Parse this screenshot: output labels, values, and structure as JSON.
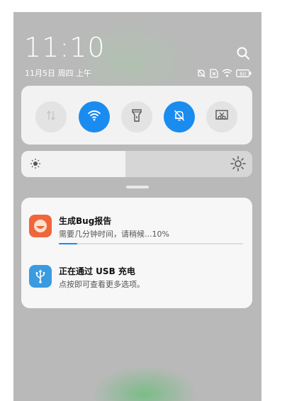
{
  "status": {
    "time": "11:10",
    "date": "11月5日 周四 上午",
    "battery_level": "60"
  },
  "icons": {
    "search": "search-icon",
    "status": [
      "do-not-disturb-icon",
      "no-sim-icon",
      "wifi-signal-icon",
      "battery-icon"
    ],
    "tiles": [
      "mobile-data-icon",
      "wifi-icon",
      "flashlight-icon",
      "mute-icon",
      "screenshot-icon"
    ]
  },
  "quick_settings": {
    "tiles": [
      {
        "id": "mobile-data",
        "active": false
      },
      {
        "id": "wifi",
        "active": true
      },
      {
        "id": "flashlight",
        "active": false
      },
      {
        "id": "mute",
        "active": true
      },
      {
        "id": "screenshot",
        "active": false
      }
    ]
  },
  "brightness": {
    "level": 0.45
  },
  "notifications": [
    {
      "title": "生成Bug报告",
      "text": "需要几分钟时间，请稍候...10%",
      "progress": 0.1,
      "icon": "bug-report-app-icon",
      "icon_color": "#f0653a"
    },
    {
      "title": "正在通过 USB 充电",
      "text": "点按即可查看更多选项。",
      "icon": "usb-icon",
      "icon_color": "#3a9be0"
    }
  ],
  "colors": {
    "accent": "#1a8cf0",
    "panel": "#f2f2f2",
    "background": "#b9b9b9"
  }
}
